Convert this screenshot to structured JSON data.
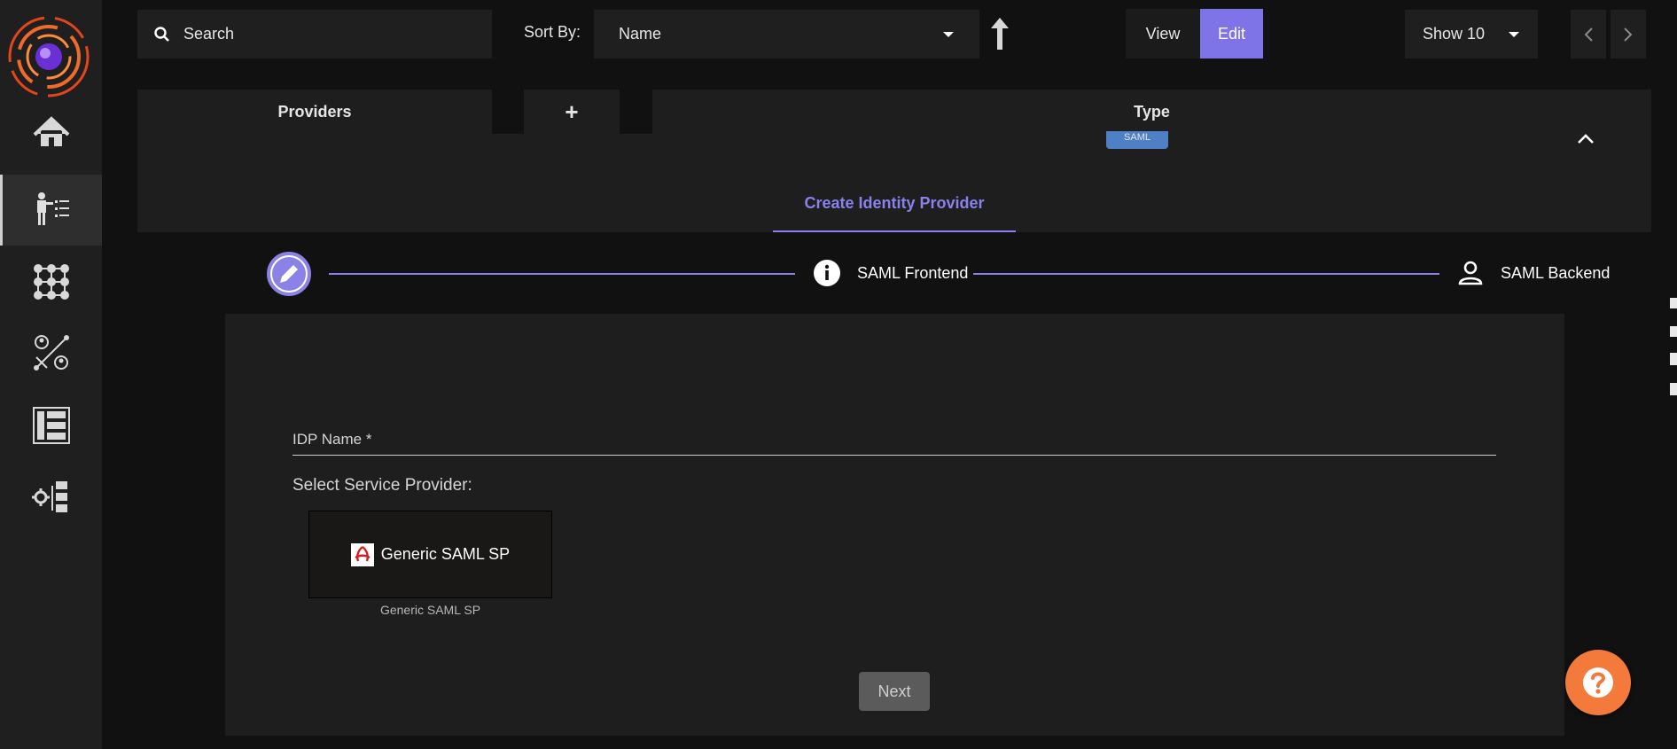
{
  "toolbar": {
    "search_placeholder": "Search",
    "sort_by_label": "Sort By:",
    "sort_value": "Name",
    "view_label": "View",
    "edit_label": "Edit",
    "show_value": "Show 10"
  },
  "table": {
    "col_providers": "Providers",
    "add_symbol": "+",
    "col_type": "Type",
    "type_badge": "SAML"
  },
  "panel": {
    "tab_label": "Create Identity Provider",
    "steps": [
      "SAML Frontend",
      "SAML Backend"
    ],
    "idp_name_label": "IDP Name *",
    "select_sp_label": "Select Service Provider:",
    "sp_card_label": "Generic SAML SP",
    "sp_caption": "Generic SAML SP",
    "next_label": "Next"
  },
  "colors": {
    "accent": "#7f73e8",
    "help": "#f47a3c",
    "badge": "#4f7fc4"
  }
}
